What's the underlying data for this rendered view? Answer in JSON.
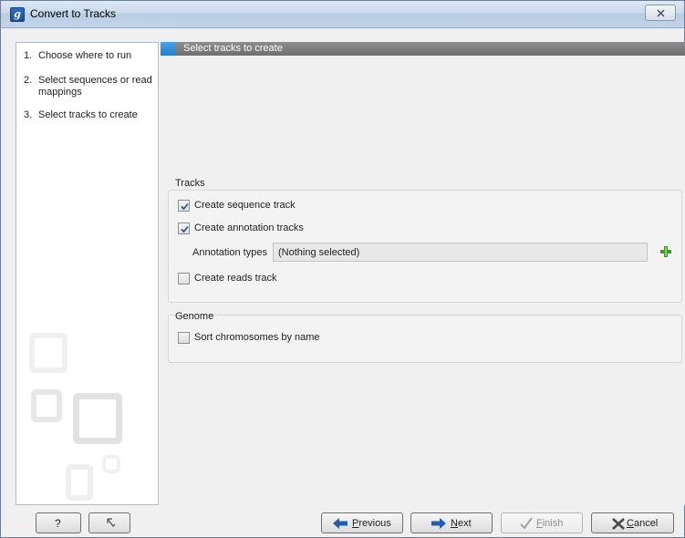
{
  "window": {
    "title": "Convert to Tracks",
    "app_icon_letter": "g",
    "close_glyph": "X"
  },
  "sidebar": {
    "steps": [
      {
        "num": "1.",
        "label": "Choose where to run"
      },
      {
        "num": "2.",
        "label": "Select sequences or read mappings"
      },
      {
        "num": "3.",
        "label": "Select tracks to create"
      }
    ]
  },
  "header": {
    "title": "Select tracks to create"
  },
  "tracks": {
    "group_title": "Tracks",
    "sequence_track": {
      "label": "Create sequence track",
      "checked": true
    },
    "annotation_tracks": {
      "label": "Create annotation tracks",
      "checked": true
    },
    "annotation_types": {
      "label": "Annotation types",
      "value": "(Nothing selected)"
    },
    "reads_track": {
      "label": "Create reads track",
      "checked": false
    }
  },
  "genome": {
    "group_title": "Genome",
    "sort_chromosomes": {
      "label": "Sort chromosomes by name",
      "checked": false
    }
  },
  "footer": {
    "help_label": "?",
    "previous_label": "Previous",
    "next_label": "Next",
    "finish_label": "Finish",
    "cancel_label": "Cancel"
  },
  "colors": {
    "accent": "#1f7fcf",
    "header_bar": "#7a7a7a",
    "plus": "#3d9a2a"
  },
  "icons": [
    "app-logo-icon",
    "close-icon",
    "checkmark-icon",
    "plus-icon",
    "help-icon",
    "reset-icon",
    "arrow-left-icon",
    "arrow-right-icon",
    "finish-check-icon",
    "cancel-x-icon"
  ]
}
